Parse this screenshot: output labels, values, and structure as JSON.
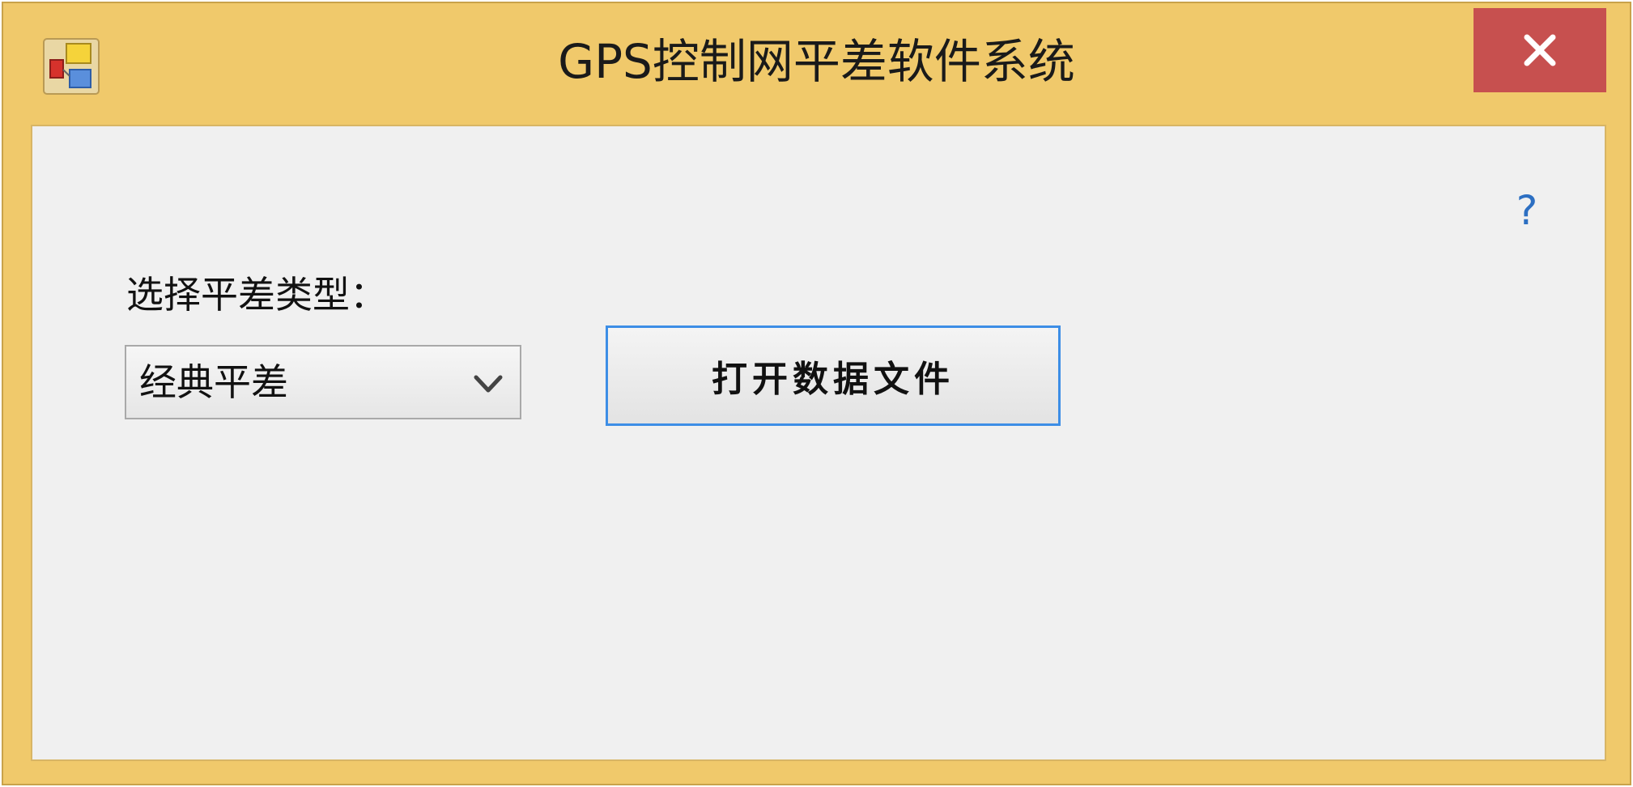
{
  "window": {
    "title": "GPS控制网平差软件系统",
    "close_symbol": "✕",
    "icons": {
      "app": "app-icon",
      "close": "close-icon",
      "help": "help-icon"
    },
    "colors": {
      "frame": "#f0c96b",
      "close_button": "#c7504f",
      "client_bg": "#f0f0f0",
      "help_icon": "#2c6fc2",
      "button_focus_border": "#3d8ee6"
    }
  },
  "form": {
    "help_symbol": "?",
    "adjustment_type_label": "选择平差类型：",
    "adjustment_type_selected": "经典平差",
    "open_file_button": "打开数据文件"
  }
}
